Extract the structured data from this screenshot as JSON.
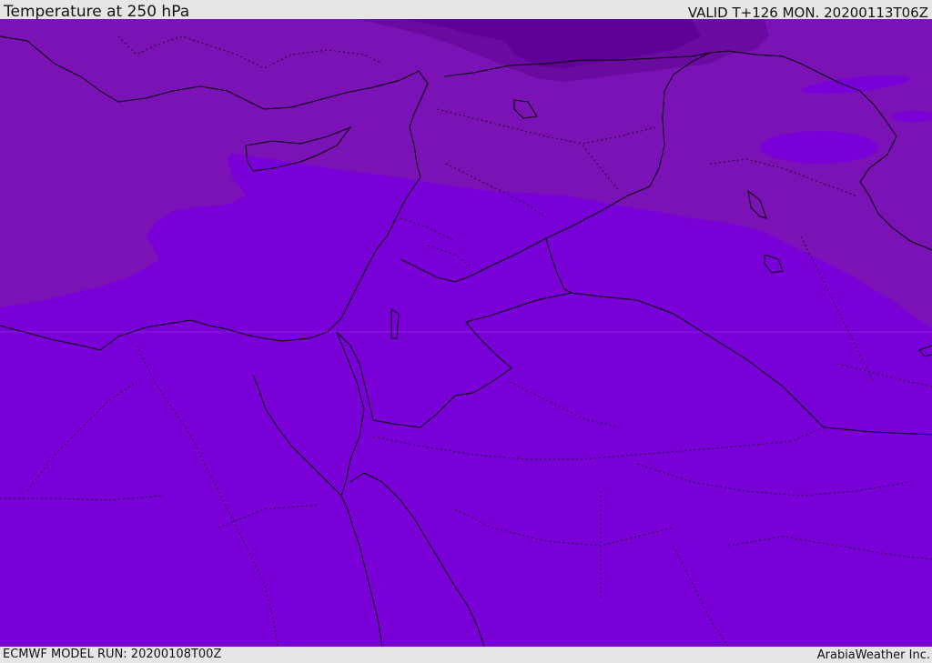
{
  "header": {
    "title": "Temperature at 250 hPa",
    "valid_time": "VALID T+126 MON. 20200113T06Z"
  },
  "footer": {
    "model_run": "ECMWF MODEL RUN: 20200108T00Z",
    "credit": "ArabiaWeather Inc."
  },
  "map": {
    "field_colors": {
      "warm_band": "#7a00d8",
      "mid_band": "#7a12b6",
      "cold_band": "#6a0aa0",
      "coldest_band": "#5e0096"
    },
    "coastline_color": "#000000",
    "border_style": "dotted"
  }
}
